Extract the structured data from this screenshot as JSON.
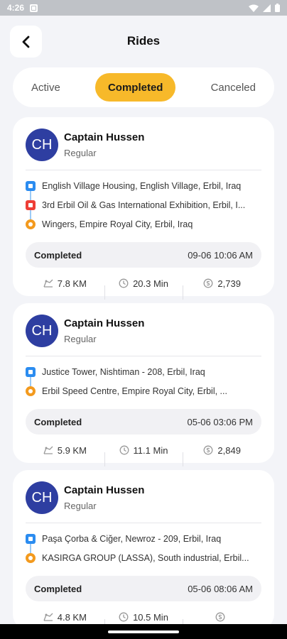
{
  "status_bar": {
    "time": "4:26"
  },
  "header": {
    "title": "Rides"
  },
  "tabs": [
    {
      "label": "Active",
      "active": false
    },
    {
      "label": "Completed",
      "active": true
    },
    {
      "label": "Canceled",
      "active": false
    }
  ],
  "rides": [
    {
      "avatar": "CH",
      "name": "Captain Hussen",
      "type": "Regular",
      "stops": [
        "English Village Housing, English Village, Erbil, Iraq",
        "3rd Erbil Oil & Gas International Exhibition, Erbil, I...",
        "Wingers, Empire Royal City, Erbil, Iraq"
      ],
      "status": "Completed",
      "datetime": "09-06 10:06 AM",
      "distance": "7.8 KM",
      "duration": "20.3 Min",
      "price": "2,739"
    },
    {
      "avatar": "CH",
      "name": "Captain Hussen",
      "type": "Regular",
      "stops": [
        "Justice Tower, Nishtiman - 208, Erbil, Iraq",
        "Erbil Speed Centre, Empire Royal City, Erbil, ..."
      ],
      "status": "Completed",
      "datetime": "05-06 03:06 PM",
      "distance": "5.9 KM",
      "duration": "11.1 Min",
      "price": "2,849"
    },
    {
      "avatar": "CH",
      "name": "Captain Hussen",
      "type": "Regular",
      "stops": [
        "Paşa Çorba & Ciğer, Newroz - 209, Erbil, Iraq",
        "KASIRGA GROUP (LASSA), South industrial, Erbil..."
      ],
      "status": "Completed",
      "datetime": "05-06 08:06 AM",
      "distance": "4.8 KM",
      "duration": "10.5 Min",
      "price": ""
    }
  ]
}
